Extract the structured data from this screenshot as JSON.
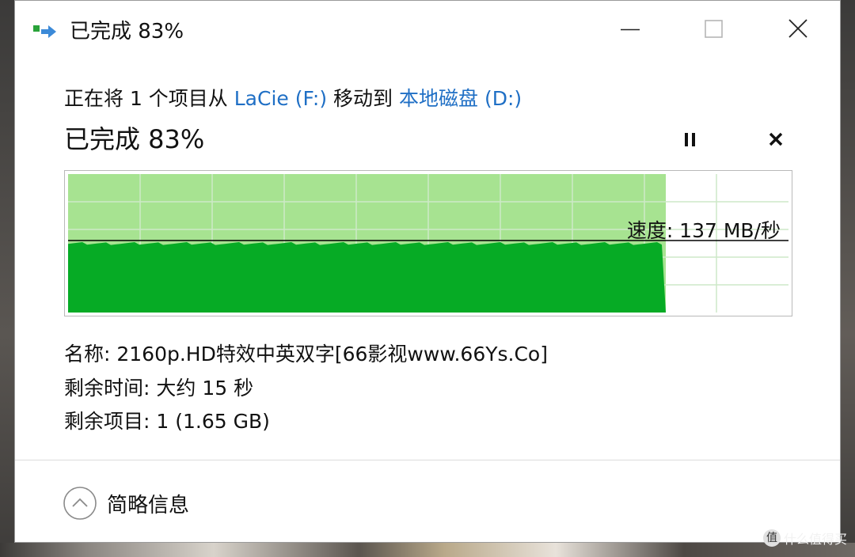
{
  "window": {
    "title": "已完成 83%",
    "minimize_glyph": "—",
    "maximize_glyph": "□",
    "close_glyph": "✕"
  },
  "transfer": {
    "prefix": "正在将 1 个项目从 ",
    "source": "LaCie (F:)",
    "middle": " 移动到 ",
    "destination": "本地磁盘 (D:)",
    "status": "已完成 83%",
    "percent": 83,
    "speed": "速度: 137 MB/秒",
    "speed_line_level": 0.52
  },
  "details": {
    "name": "名称: 2160p.HD特效中英双字[66影视www.66Ys.Co]",
    "time_left": "剩余时间: 大约 15 秒",
    "items_left": "剩余项目: 1 (1.65 GB)"
  },
  "footer": {
    "toggle_label": "简略信息"
  },
  "watermark": {
    "badge": "值",
    "text": "什么值得买"
  },
  "colors": {
    "accent_link": "#1f6fc5",
    "graph_dark_green": "#06ab25",
    "graph_light_green": "#a7e391",
    "grid": "#cde9c8"
  }
}
